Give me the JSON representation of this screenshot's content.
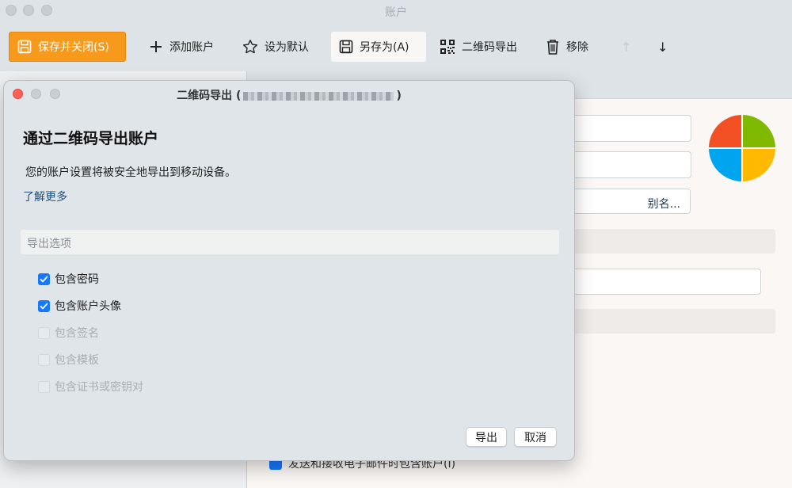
{
  "window": {
    "title": "账户"
  },
  "toolbar": {
    "save_close": "保存并关闭(S)",
    "add_account": "添加账户",
    "set_default": "设为默认",
    "save_as": "另存为(A)",
    "qr_export": "二维码导出",
    "remove": "移除",
    "move_up": "↑",
    "move_down": "↓"
  },
  "background": {
    "alias_button": "别名...",
    "bottom_checkbox_text": "发送和接收电子邮件时包含账户(I)"
  },
  "dialog": {
    "title": "二维码导出",
    "title_paren_open": "(",
    "title_paren_close": ")",
    "heading": "通过二维码导出账户",
    "description": "您的账户设置将被安全地导出到移动设备。",
    "learn_more": "了解更多",
    "options_header": "导出选项",
    "options": [
      {
        "label": "包含密码",
        "checked": true,
        "enabled": true
      },
      {
        "label": "包含账户头像",
        "checked": true,
        "enabled": true
      },
      {
        "label": "包含签名",
        "checked": false,
        "enabled": false
      },
      {
        "label": "包含模板",
        "checked": false,
        "enabled": false
      },
      {
        "label": "包含证书或密钥对",
        "checked": false,
        "enabled": false
      }
    ],
    "export_button": "导出",
    "cancel_button": "取消"
  },
  "colors": {
    "accent_orange": "#f79a1c",
    "checkbox_blue": "#1677ff",
    "link_blue": "#1d4f7c",
    "ms_red": "#f25022",
    "ms_green": "#7fba00",
    "ms_blue": "#00a4ef",
    "ms_yellow": "#ffb900"
  },
  "icons": {
    "save": "floppy-icon",
    "add": "plus-icon",
    "default": "star-icon",
    "save_as": "floppy-icon",
    "qr": "qr-code-icon",
    "remove": "trash-icon",
    "check": "checkmark-icon",
    "account_logo": "microsoft-logo"
  }
}
